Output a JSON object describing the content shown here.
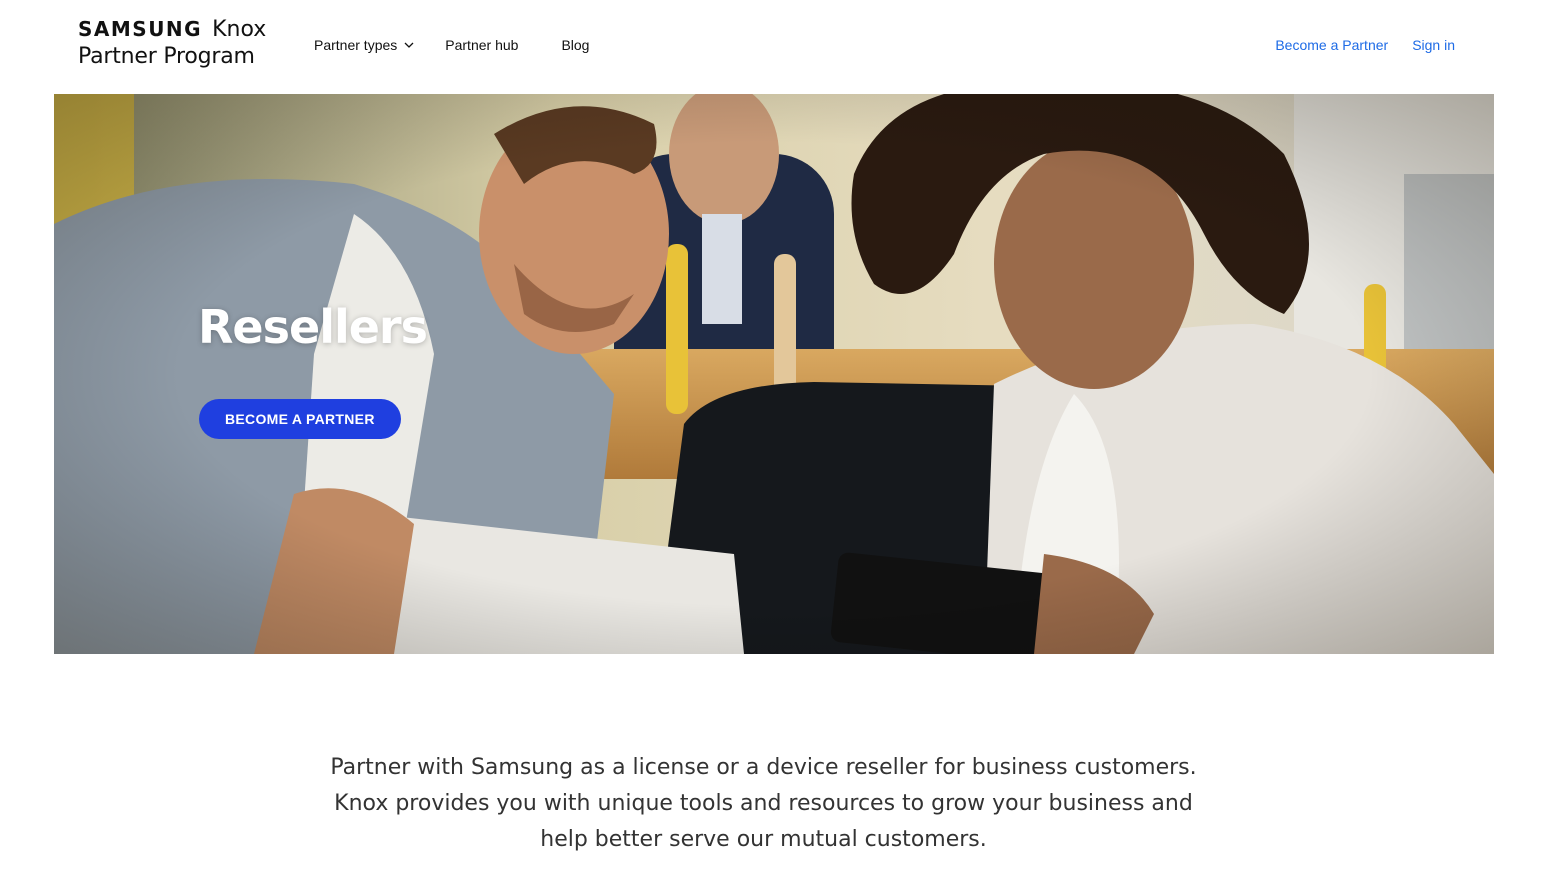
{
  "header": {
    "logo_brand": "SAMSUNG",
    "logo_product": "Knox",
    "logo_subtitle": "Partner Program",
    "nav": {
      "partner_types": "Partner types",
      "partner_hub": "Partner hub",
      "blog": "Blog"
    },
    "become_partner_link": "Become a Partner",
    "sign_in_link": "Sign in"
  },
  "hero": {
    "title": "Resellers",
    "cta_label": "BECOME A PARTNER"
  },
  "intro": {
    "line1": "Partner with Samsung as a license or a device reseller for business customers.",
    "line2": "Knox provides you with unique tools and resources to grow your business and",
    "line3": "help better serve our mutual customers."
  },
  "colors": {
    "link_blue": "#1e6be6",
    "cta_blue": "#1f3fe0",
    "text_dark": "#111111",
    "body_text": "#333333"
  },
  "icons": {
    "nav_dropdown": "chevron-down-icon"
  }
}
